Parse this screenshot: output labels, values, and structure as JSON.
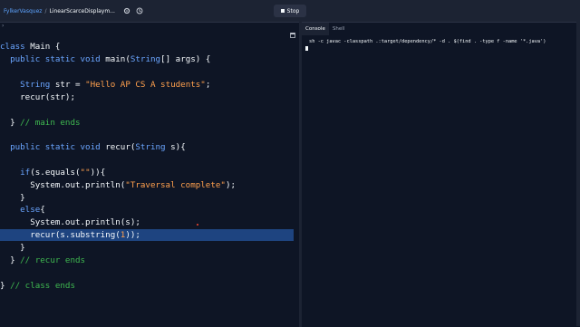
{
  "header": {
    "user": "FylkerVasquez",
    "separator": "/",
    "project": "LinearScarceDisplaym...",
    "stop_label": "Stop"
  },
  "console": {
    "tabs": [
      {
        "label": "Console",
        "active": true
      },
      {
        "label": "Shell",
        "active": false
      }
    ],
    "command": "sh -c javac -classpath .:target/dependency/* -d . $(find . -type f -name '*.java')"
  },
  "code": {
    "lines": [
      "class Main {",
      "  public static void main(String[] args) {",
      "",
      "    String str = \"Hello AP CS A students\";",
      "    recur(str);",
      "",
      "  } // main ends",
      "",
      "  public static void recur(String s){",
      "",
      "    if(s.equals(\"\")){",
      "      System.out.println(\"Traversal complete\");",
      "    }",
      "    else{",
      "      System.out.println(s);",
      "      recur(s.substring(1));",
      "    }",
      "  } // recur ends",
      "",
      "} // class ends"
    ],
    "highlighted_line": 15
  },
  "icons": {
    "settings": "gear-icon",
    "history": "history-icon",
    "stop": "stop-icon",
    "panel": "panel-icon",
    "collapse": "chevron-icon"
  }
}
